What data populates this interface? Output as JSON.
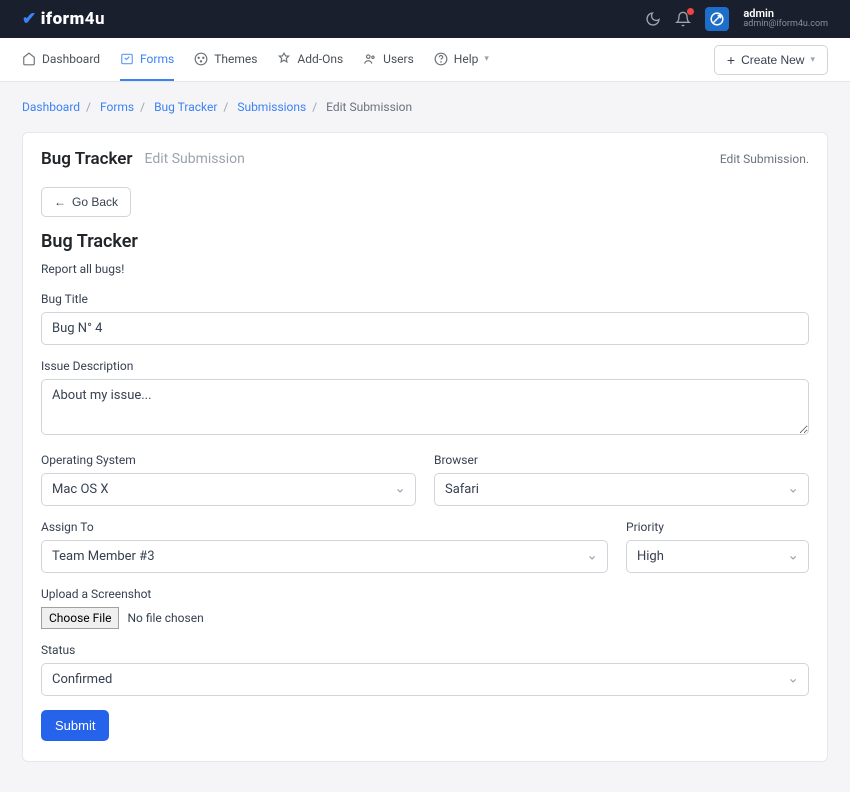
{
  "brand": {
    "text": "iform",
    "accent": "4u"
  },
  "user": {
    "name": "admin",
    "email": "admin@iform4u.com"
  },
  "nav": {
    "items": [
      {
        "label": "Dashboard"
      },
      {
        "label": "Forms"
      },
      {
        "label": "Themes"
      },
      {
        "label": "Add-Ons"
      },
      {
        "label": "Users"
      },
      {
        "label": "Help"
      }
    ],
    "active_index": 1,
    "create_label": "Create New"
  },
  "breadcrumb": {
    "items": [
      "Dashboard",
      "Forms",
      "Bug Tracker",
      "Submissions"
    ],
    "current": "Edit Submission"
  },
  "card": {
    "title": "Bug Tracker",
    "subtitle": "Edit Submission",
    "right_note": "Edit Submission.",
    "go_back": "Go Back"
  },
  "form": {
    "heading": "Bug Tracker",
    "description": "Report all bugs!",
    "fields": {
      "bug_title": {
        "label": "Bug Title",
        "value": "Bug N° 4"
      },
      "issue_description": {
        "label": "Issue Description",
        "value": "About my issue..."
      },
      "operating_system": {
        "label": "Operating System",
        "value": "Mac OS X"
      },
      "browser": {
        "label": "Browser",
        "value": "Safari"
      },
      "assign_to": {
        "label": "Assign To",
        "value": "Team Member #3"
      },
      "priority": {
        "label": "Priority",
        "value": "High"
      },
      "upload_screenshot": {
        "label": "Upload a Screenshot",
        "button": "Choose File",
        "status": "No file chosen"
      },
      "status": {
        "label": "Status",
        "value": "Confirmed"
      }
    },
    "submit_label": "Submit"
  }
}
